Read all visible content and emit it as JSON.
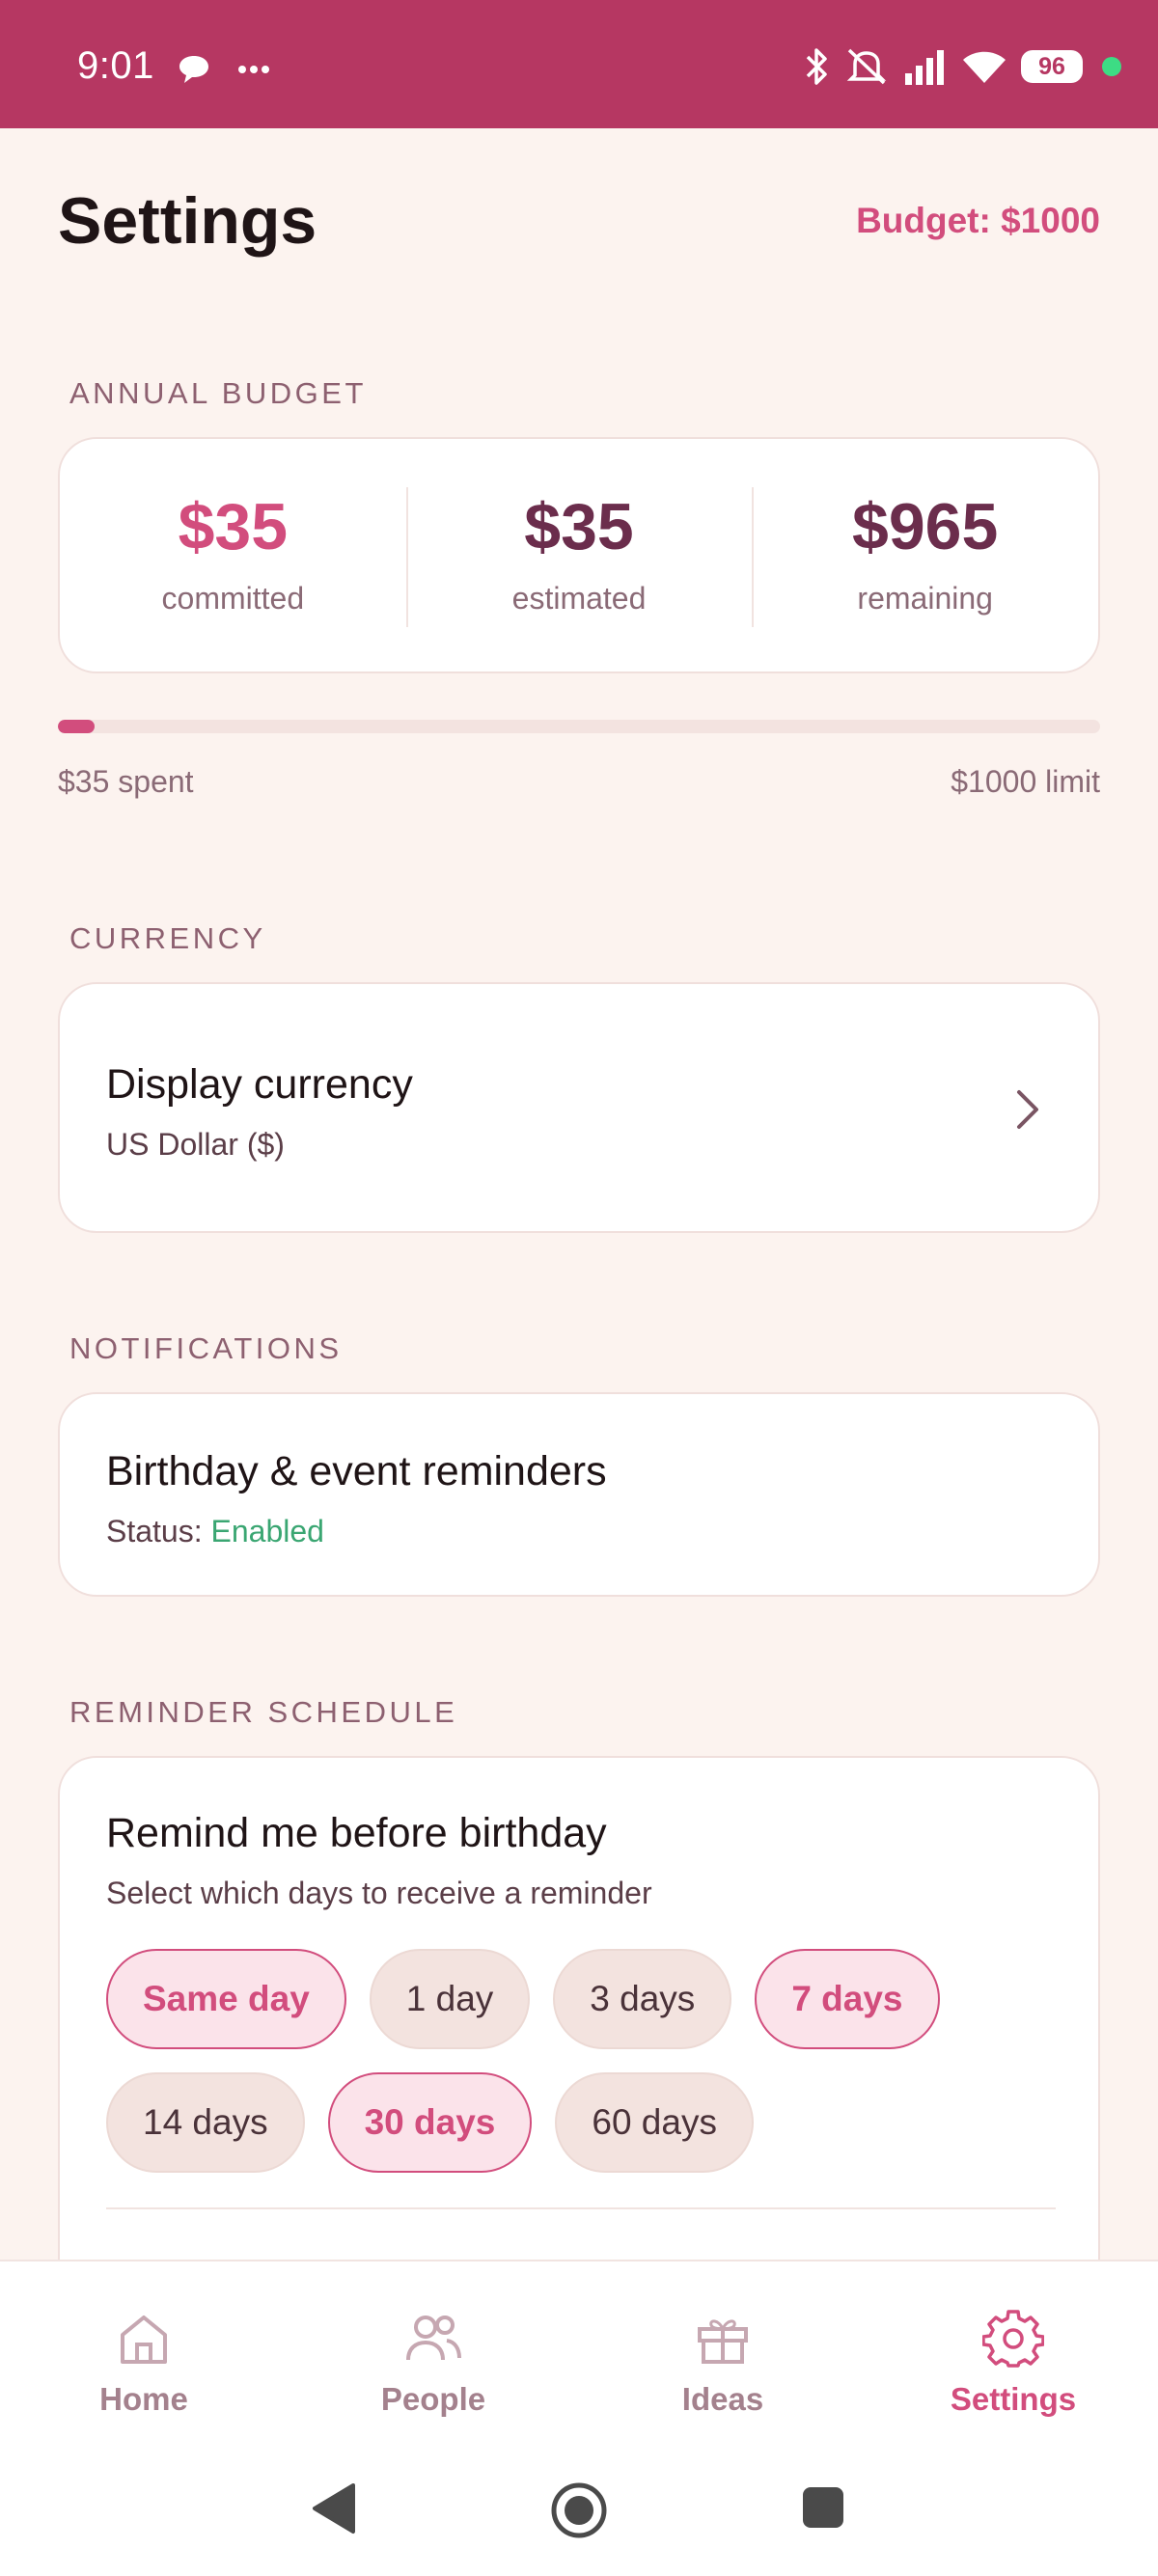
{
  "status_bar": {
    "time": "9:01",
    "battery": "96",
    "icons": [
      "chat-bubble-icon",
      "more-dots-icon",
      "bluetooth-icon",
      "mute-icon",
      "signal-icon",
      "wifi-icon",
      "battery-icon"
    ]
  },
  "header": {
    "title": "Settings",
    "budget": "Budget: $1000"
  },
  "annual_budget": {
    "section_label": "ANNUAL BUDGET",
    "stats": [
      {
        "value": "$35",
        "label": "committed"
      },
      {
        "value": "$35",
        "label": "estimated"
      },
      {
        "value": "$965",
        "label": "remaining"
      }
    ],
    "progress_fraction": 0.035,
    "spent_label": "$35 spent",
    "limit_label": "$1000 limit"
  },
  "currency": {
    "section_label": "CURRENCY",
    "title": "Display currency",
    "value": "US Dollar ($)"
  },
  "notifications": {
    "section_label": "NOTIFICATIONS",
    "title": "Birthday & event reminders",
    "status_prefix": "Status: ",
    "status_value": "Enabled"
  },
  "reminder_schedule": {
    "section_label": "REMINDER SCHEDULE",
    "title": "Remind me before birthday",
    "subtitle": "Select which days to receive a reminder",
    "options": [
      {
        "label": "Same day",
        "selected": true
      },
      {
        "label": "1 day",
        "selected": false
      },
      {
        "label": "3 days",
        "selected": false
      },
      {
        "label": "7 days",
        "selected": true
      },
      {
        "label": "14 days",
        "selected": false
      },
      {
        "label": "30 days",
        "selected": true
      },
      {
        "label": "60 days",
        "selected": false
      }
    ]
  },
  "bottom_nav": {
    "items": [
      {
        "label": "Home",
        "icon": "home-icon",
        "active": false
      },
      {
        "label": "People",
        "icon": "people-icon",
        "active": false
      },
      {
        "label": "Ideas",
        "icon": "gift-icon",
        "active": false
      },
      {
        "label": "Settings",
        "icon": "gear-icon",
        "active": true
      }
    ]
  },
  "colors": {
    "status_bar": "#b63762",
    "accent": "#d24d7d",
    "background": "#fcf3ef",
    "enabled": "#3aa672"
  }
}
